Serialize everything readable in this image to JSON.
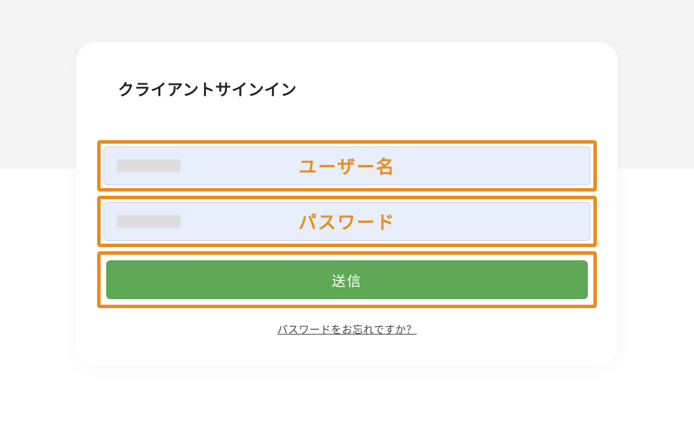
{
  "card": {
    "title": "クライアントサインイン"
  },
  "form": {
    "username_label": "ユーザー名",
    "password_label": "パスワード",
    "submit_label": "送信",
    "forgot_password": "パスワードをお忘れですか？"
  },
  "colors": {
    "highlight": "#e88c1e",
    "submit": "#5fa856",
    "input_bg": "#e8eefb"
  }
}
